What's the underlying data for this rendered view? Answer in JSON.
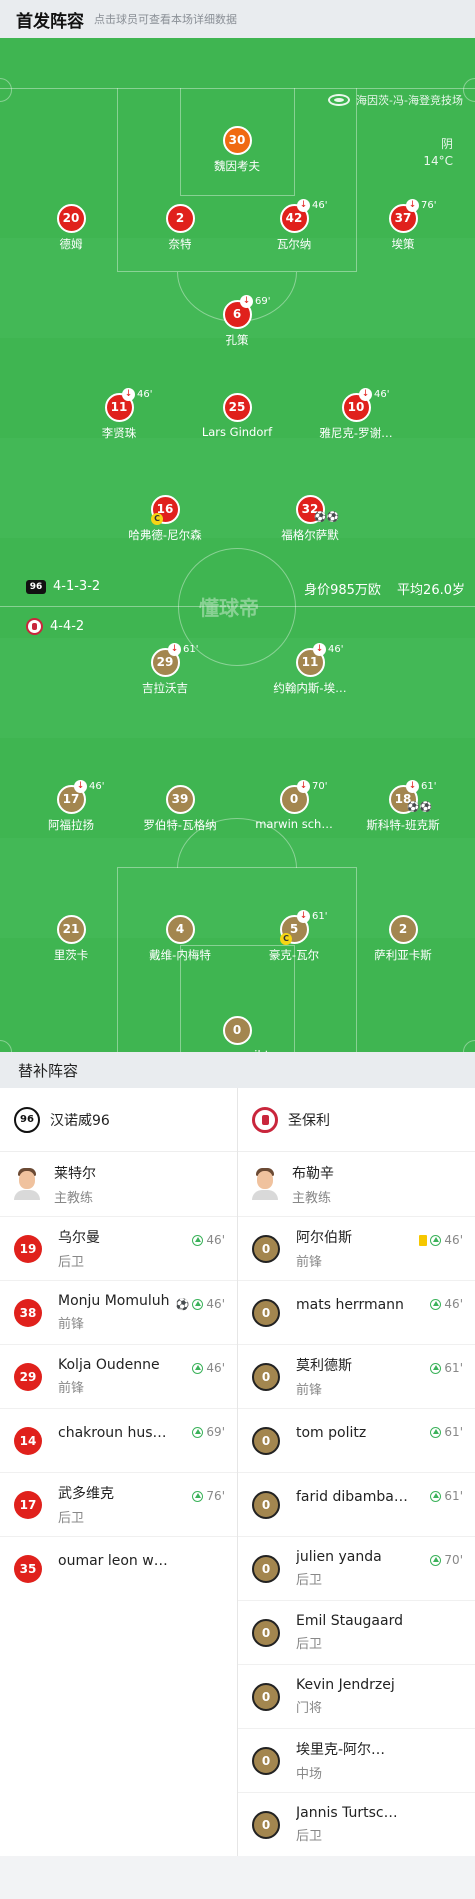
{
  "header": {
    "title": "首发阵容",
    "subtitle": "点击球员可查看本场详细数据"
  },
  "venue": {
    "name": "海因茨-冯-海登竞技场",
    "icon": "stadium-icon"
  },
  "weather": {
    "condition": "阴",
    "temp": "14°C"
  },
  "watermark": "懂球帝",
  "home": {
    "formation": "4-1-3-2",
    "value": "身价985万欧",
    "avg_age": "平均26.0岁",
    "players": [
      {
        "num": "30",
        "name": "魏因考夫",
        "color": "orange"
      },
      {
        "num": "20",
        "name": "德姆",
        "color": "red"
      },
      {
        "num": "2",
        "name": "奈特",
        "color": "red"
      },
      {
        "num": "42",
        "name": "瓦尔纳",
        "color": "red",
        "sub": "46'"
      },
      {
        "num": "37",
        "name": "埃策",
        "color": "red",
        "sub": "76'"
      },
      {
        "num": "6",
        "name": "孔策",
        "color": "red",
        "sub": "69'"
      },
      {
        "num": "11",
        "name": "李贤珠",
        "color": "red",
        "sub": "46'"
      },
      {
        "num": "25",
        "name": "Lars Gindorf",
        "color": "red"
      },
      {
        "num": "10",
        "name": "雅尼克-罗谢…",
        "color": "red",
        "sub": "46'"
      },
      {
        "num": "16",
        "name": "哈弗德-尼尔森",
        "color": "red",
        "captain": "C"
      },
      {
        "num": "32",
        "name": "福格尔萨默",
        "color": "red",
        "balls": "⚽⚽"
      }
    ]
  },
  "away": {
    "formation": "4-4-2",
    "players": [
      {
        "num": "29",
        "name": "吉拉沃吉",
        "sub": "61'"
      },
      {
        "num": "11",
        "name": "约翰内斯-埃…",
        "sub": "46'"
      },
      {
        "num": "17",
        "name": "阿福拉扬",
        "sub": "46'"
      },
      {
        "num": "39",
        "name": "罗伯特-瓦格纳"
      },
      {
        "num": "0",
        "name": "marwin sch…",
        "sub": "70'"
      },
      {
        "num": "18",
        "name": "斯科特-班克斯",
        "sub": "61'",
        "balls": "⚽⚽"
      },
      {
        "num": "21",
        "name": "里茨卡"
      },
      {
        "num": "4",
        "name": "戴维-内梅特"
      },
      {
        "num": "5",
        "name": "豪克-瓦尔",
        "sub": "61'",
        "captain": "C"
      },
      {
        "num": "2",
        "name": "萨利亚卡斯"
      },
      {
        "num": "0",
        "name": "ronny seibt"
      }
    ]
  },
  "subs_title": "替补阵容",
  "subs_home": {
    "team": "汉诺威96",
    "coach": {
      "name": "莱特尔",
      "role": "主教练"
    },
    "players": [
      {
        "num": "19",
        "name": "乌尔曼",
        "pos": "后卫",
        "time": "46'"
      },
      {
        "num": "38",
        "name": "Monju Momuluh",
        "pos": "前锋",
        "time": "46'",
        "ball": "⚽"
      },
      {
        "num": "29",
        "name": "Kolja Oudenne",
        "pos": "前锋",
        "time": "46'"
      },
      {
        "num": "14",
        "name": "chakroun hus…",
        "pos": "",
        "time": "69'"
      },
      {
        "num": "17",
        "name": "武多维克",
        "pos": "后卫",
        "time": "76'"
      },
      {
        "num": "35",
        "name": "oumar leon w…",
        "pos": "",
        "time": ""
      }
    ]
  },
  "subs_away": {
    "team": "圣保利",
    "coach": {
      "name": "布勒辛",
      "role": "主教练"
    },
    "players": [
      {
        "num": "0",
        "name": "阿尔伯斯",
        "pos": "前锋",
        "time": "46'",
        "card": "yellow"
      },
      {
        "num": "0",
        "name": "mats herrmann",
        "pos": "",
        "time": "46'"
      },
      {
        "num": "0",
        "name": "莫利德斯",
        "pos": "前锋",
        "time": "61'"
      },
      {
        "num": "0",
        "name": "tom politz",
        "pos": "",
        "time": "61'"
      },
      {
        "num": "0",
        "name": "farid dibamba…",
        "pos": "",
        "time": "61'"
      },
      {
        "num": "0",
        "name": "julien yanda",
        "pos": "后卫",
        "time": "70'"
      },
      {
        "num": "0",
        "name": "Emil Staugaard",
        "pos": "后卫",
        "time": ""
      },
      {
        "num": "0",
        "name": "Kevin Jendrzej",
        "pos": "门将",
        "time": ""
      },
      {
        "num": "0",
        "name": "埃里克-阿尔…",
        "pos": "中场",
        "time": ""
      },
      {
        "num": "0",
        "name": "Jannis Turtsc…",
        "pos": "后卫",
        "time": ""
      }
    ]
  }
}
